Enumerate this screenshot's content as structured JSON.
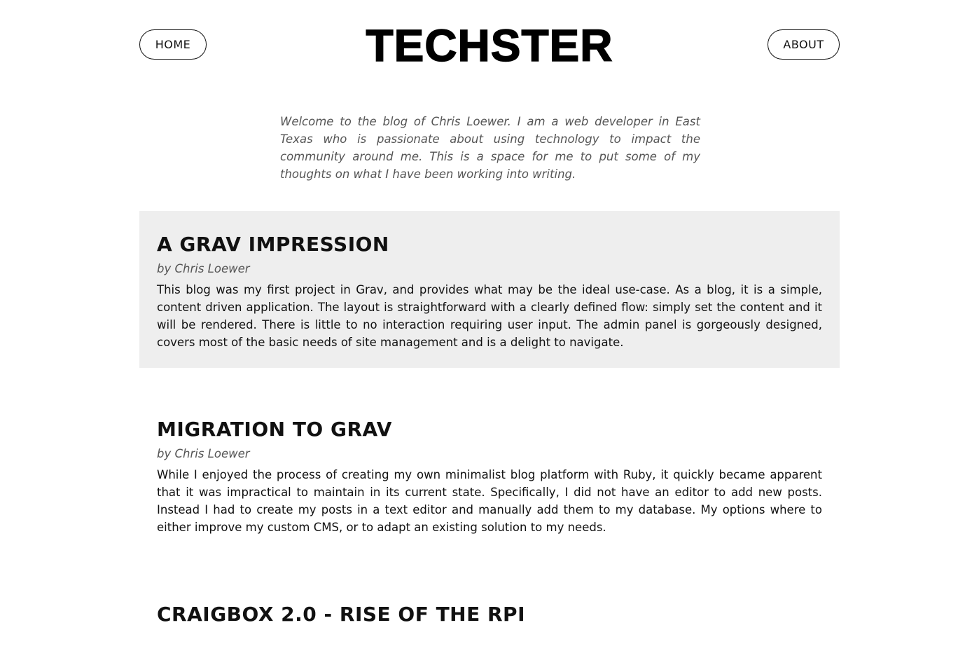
{
  "header": {
    "title": "TECHSTER",
    "nav_home": "HOME",
    "nav_about": "ABOUT"
  },
  "intro": "Welcome to the blog of Chris Loewer. I am a web developer in East Texas who is passionate about using technology to impact the community around me. This is a space for me to put some of my thoughts on what I have been working into writing.",
  "posts": [
    {
      "title": "A GRAV IMPRESSION",
      "author": "by Chris Loewer",
      "excerpt": "This blog was my first project in Grav, and provides what may be the ideal use-case. As a blog, it is a simple, content driven application. The layout is straightforward with a clearly defined flow: simply set the content and it will be rendered. There is little to no interaction requiring user input. The admin panel is gorgeously designed, covers most of the basic needs of site management and is a delight to navigate."
    },
    {
      "title": "MIGRATION TO GRAV",
      "author": "by Chris Loewer",
      "excerpt": "While I enjoyed the process of creating my own minimalist blog platform with Ruby, it quickly became apparent that it was impractical to maintain in its current state. Specifically, I did not have an editor to add new posts. Instead I had to create my posts in a text editor and manually add them to my database. My options where to either improve my custom CMS, or to adapt an existing solution to my needs."
    },
    {
      "title": "CRAIGBOX 2.0 - RISE OF THE RPI"
    }
  ]
}
